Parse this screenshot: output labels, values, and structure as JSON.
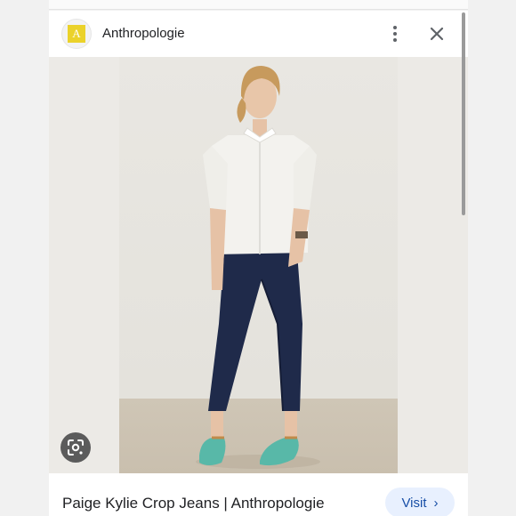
{
  "header": {
    "logo_letter": "A",
    "site_name": "Anthropologie"
  },
  "icons": {
    "more": "more-vert-icon",
    "close": "close-icon",
    "lens": "google-lens-icon",
    "chevron": "chevron-right-icon"
  },
  "image": {
    "subject": "woman wearing white button-down shirt, dark cropped skinny jeans and turquoise flats"
  },
  "footer": {
    "title": "Paige Kylie Crop Jeans | Anthropologie",
    "visit_label": "Visit",
    "visit_chevron": "›"
  },
  "colors": {
    "logo_bg": "#ebd22a",
    "visit_bg": "#e8f0fe",
    "visit_text": "#174ea6",
    "lens_bg": "#5b5b5b"
  }
}
